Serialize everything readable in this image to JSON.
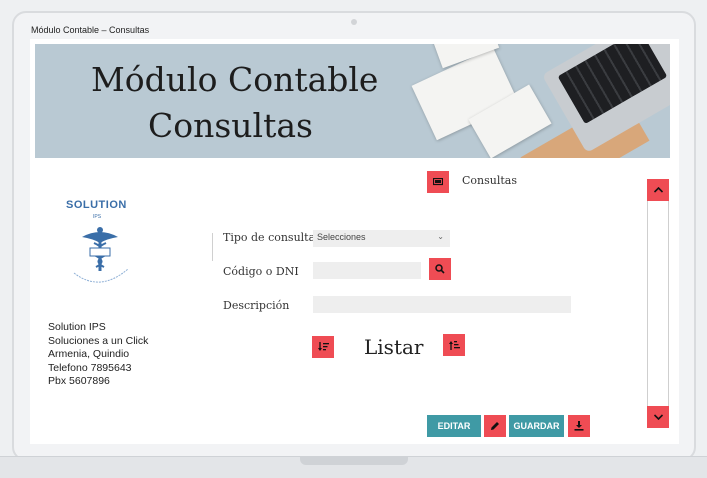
{
  "window": {
    "title": "Módulo Contable – Consultas"
  },
  "banner": {
    "line1": "Módulo Contable",
    "line2": "Consultas"
  },
  "logo": {
    "name": "SOLUTION",
    "sub": "IPS"
  },
  "company": {
    "lines": [
      "Solution IPS",
      "Soluciones a un Click",
      "Armenia, Quindio",
      "Telefono 7895643",
      "Pbx 5607896"
    ]
  },
  "header": {
    "consultas_label": "Consultas"
  },
  "form": {
    "tipo_label": "Tipo de consulta",
    "tipo_value": "Selecciones",
    "codigo_label": "Código o DNI",
    "descripcion_label": "Descripción",
    "listar_label": "Listar"
  },
  "actions": {
    "editar": "EDITAR",
    "guardar": "GUARDAR"
  },
  "colors": {
    "accent_red": "#ef4c54",
    "teal": "#3f9aa5"
  }
}
